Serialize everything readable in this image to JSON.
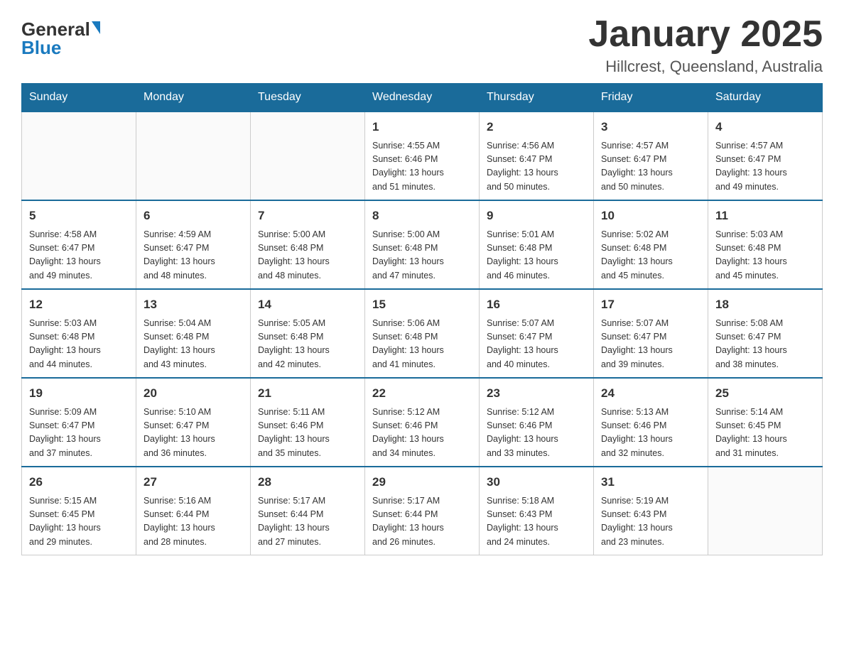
{
  "header": {
    "logo_text_black": "General",
    "logo_text_blue": "Blue",
    "month_title": "January 2025",
    "location": "Hillcrest, Queensland, Australia"
  },
  "days_of_week": [
    "Sunday",
    "Monday",
    "Tuesday",
    "Wednesday",
    "Thursday",
    "Friday",
    "Saturday"
  ],
  "weeks": [
    [
      {
        "day": "",
        "info": ""
      },
      {
        "day": "",
        "info": ""
      },
      {
        "day": "",
        "info": ""
      },
      {
        "day": "1",
        "info": "Sunrise: 4:55 AM\nSunset: 6:46 PM\nDaylight: 13 hours\nand 51 minutes."
      },
      {
        "day": "2",
        "info": "Sunrise: 4:56 AM\nSunset: 6:47 PM\nDaylight: 13 hours\nand 50 minutes."
      },
      {
        "day": "3",
        "info": "Sunrise: 4:57 AM\nSunset: 6:47 PM\nDaylight: 13 hours\nand 50 minutes."
      },
      {
        "day": "4",
        "info": "Sunrise: 4:57 AM\nSunset: 6:47 PM\nDaylight: 13 hours\nand 49 minutes."
      }
    ],
    [
      {
        "day": "5",
        "info": "Sunrise: 4:58 AM\nSunset: 6:47 PM\nDaylight: 13 hours\nand 49 minutes."
      },
      {
        "day": "6",
        "info": "Sunrise: 4:59 AM\nSunset: 6:47 PM\nDaylight: 13 hours\nand 48 minutes."
      },
      {
        "day": "7",
        "info": "Sunrise: 5:00 AM\nSunset: 6:48 PM\nDaylight: 13 hours\nand 48 minutes."
      },
      {
        "day": "8",
        "info": "Sunrise: 5:00 AM\nSunset: 6:48 PM\nDaylight: 13 hours\nand 47 minutes."
      },
      {
        "day": "9",
        "info": "Sunrise: 5:01 AM\nSunset: 6:48 PM\nDaylight: 13 hours\nand 46 minutes."
      },
      {
        "day": "10",
        "info": "Sunrise: 5:02 AM\nSunset: 6:48 PM\nDaylight: 13 hours\nand 45 minutes."
      },
      {
        "day": "11",
        "info": "Sunrise: 5:03 AM\nSunset: 6:48 PM\nDaylight: 13 hours\nand 45 minutes."
      }
    ],
    [
      {
        "day": "12",
        "info": "Sunrise: 5:03 AM\nSunset: 6:48 PM\nDaylight: 13 hours\nand 44 minutes."
      },
      {
        "day": "13",
        "info": "Sunrise: 5:04 AM\nSunset: 6:48 PM\nDaylight: 13 hours\nand 43 minutes."
      },
      {
        "day": "14",
        "info": "Sunrise: 5:05 AM\nSunset: 6:48 PM\nDaylight: 13 hours\nand 42 minutes."
      },
      {
        "day": "15",
        "info": "Sunrise: 5:06 AM\nSunset: 6:48 PM\nDaylight: 13 hours\nand 41 minutes."
      },
      {
        "day": "16",
        "info": "Sunrise: 5:07 AM\nSunset: 6:47 PM\nDaylight: 13 hours\nand 40 minutes."
      },
      {
        "day": "17",
        "info": "Sunrise: 5:07 AM\nSunset: 6:47 PM\nDaylight: 13 hours\nand 39 minutes."
      },
      {
        "day": "18",
        "info": "Sunrise: 5:08 AM\nSunset: 6:47 PM\nDaylight: 13 hours\nand 38 minutes."
      }
    ],
    [
      {
        "day": "19",
        "info": "Sunrise: 5:09 AM\nSunset: 6:47 PM\nDaylight: 13 hours\nand 37 minutes."
      },
      {
        "day": "20",
        "info": "Sunrise: 5:10 AM\nSunset: 6:47 PM\nDaylight: 13 hours\nand 36 minutes."
      },
      {
        "day": "21",
        "info": "Sunrise: 5:11 AM\nSunset: 6:46 PM\nDaylight: 13 hours\nand 35 minutes."
      },
      {
        "day": "22",
        "info": "Sunrise: 5:12 AM\nSunset: 6:46 PM\nDaylight: 13 hours\nand 34 minutes."
      },
      {
        "day": "23",
        "info": "Sunrise: 5:12 AM\nSunset: 6:46 PM\nDaylight: 13 hours\nand 33 minutes."
      },
      {
        "day": "24",
        "info": "Sunrise: 5:13 AM\nSunset: 6:46 PM\nDaylight: 13 hours\nand 32 minutes."
      },
      {
        "day": "25",
        "info": "Sunrise: 5:14 AM\nSunset: 6:45 PM\nDaylight: 13 hours\nand 31 minutes."
      }
    ],
    [
      {
        "day": "26",
        "info": "Sunrise: 5:15 AM\nSunset: 6:45 PM\nDaylight: 13 hours\nand 29 minutes."
      },
      {
        "day": "27",
        "info": "Sunrise: 5:16 AM\nSunset: 6:44 PM\nDaylight: 13 hours\nand 28 minutes."
      },
      {
        "day": "28",
        "info": "Sunrise: 5:17 AM\nSunset: 6:44 PM\nDaylight: 13 hours\nand 27 minutes."
      },
      {
        "day": "29",
        "info": "Sunrise: 5:17 AM\nSunset: 6:44 PM\nDaylight: 13 hours\nand 26 minutes."
      },
      {
        "day": "30",
        "info": "Sunrise: 5:18 AM\nSunset: 6:43 PM\nDaylight: 13 hours\nand 24 minutes."
      },
      {
        "day": "31",
        "info": "Sunrise: 5:19 AM\nSunset: 6:43 PM\nDaylight: 13 hours\nand 23 minutes."
      },
      {
        "day": "",
        "info": ""
      }
    ]
  ]
}
